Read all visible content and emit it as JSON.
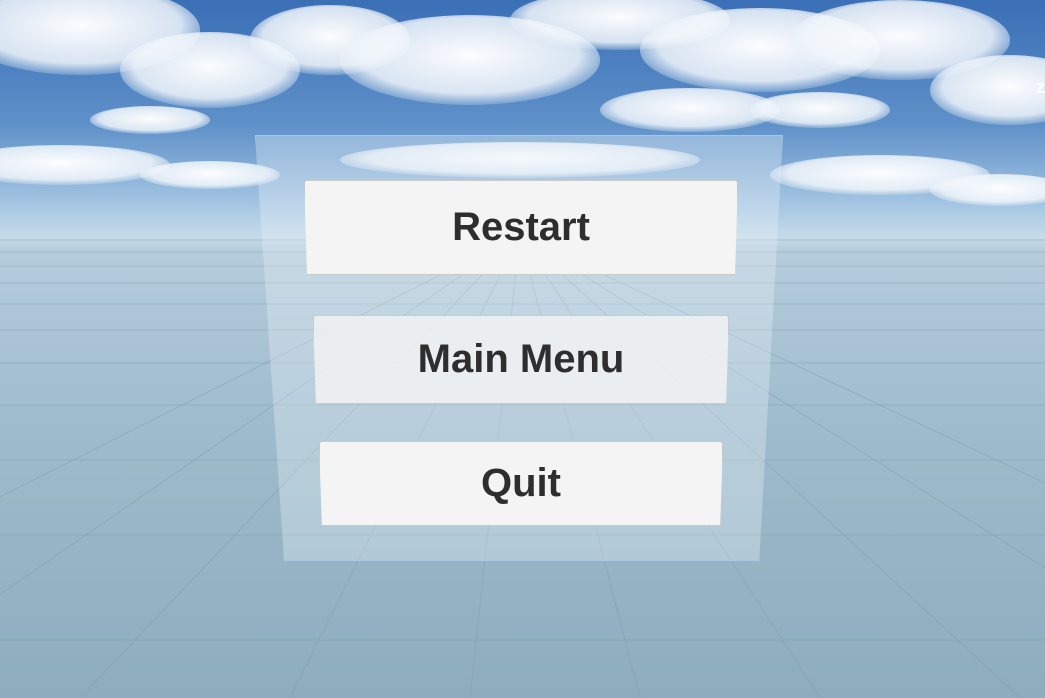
{
  "corner_label": "z",
  "menu": {
    "restart_label": "Restart",
    "main_menu_label": "Main Menu",
    "quit_label": "Quit"
  },
  "colors": {
    "sky_top": "#3f72b8",
    "sky_horizon": "#b9d3e6",
    "ground": "#9bb8c8",
    "button_text": "#2e2e2e",
    "button_bg": "#f4f4f4"
  }
}
